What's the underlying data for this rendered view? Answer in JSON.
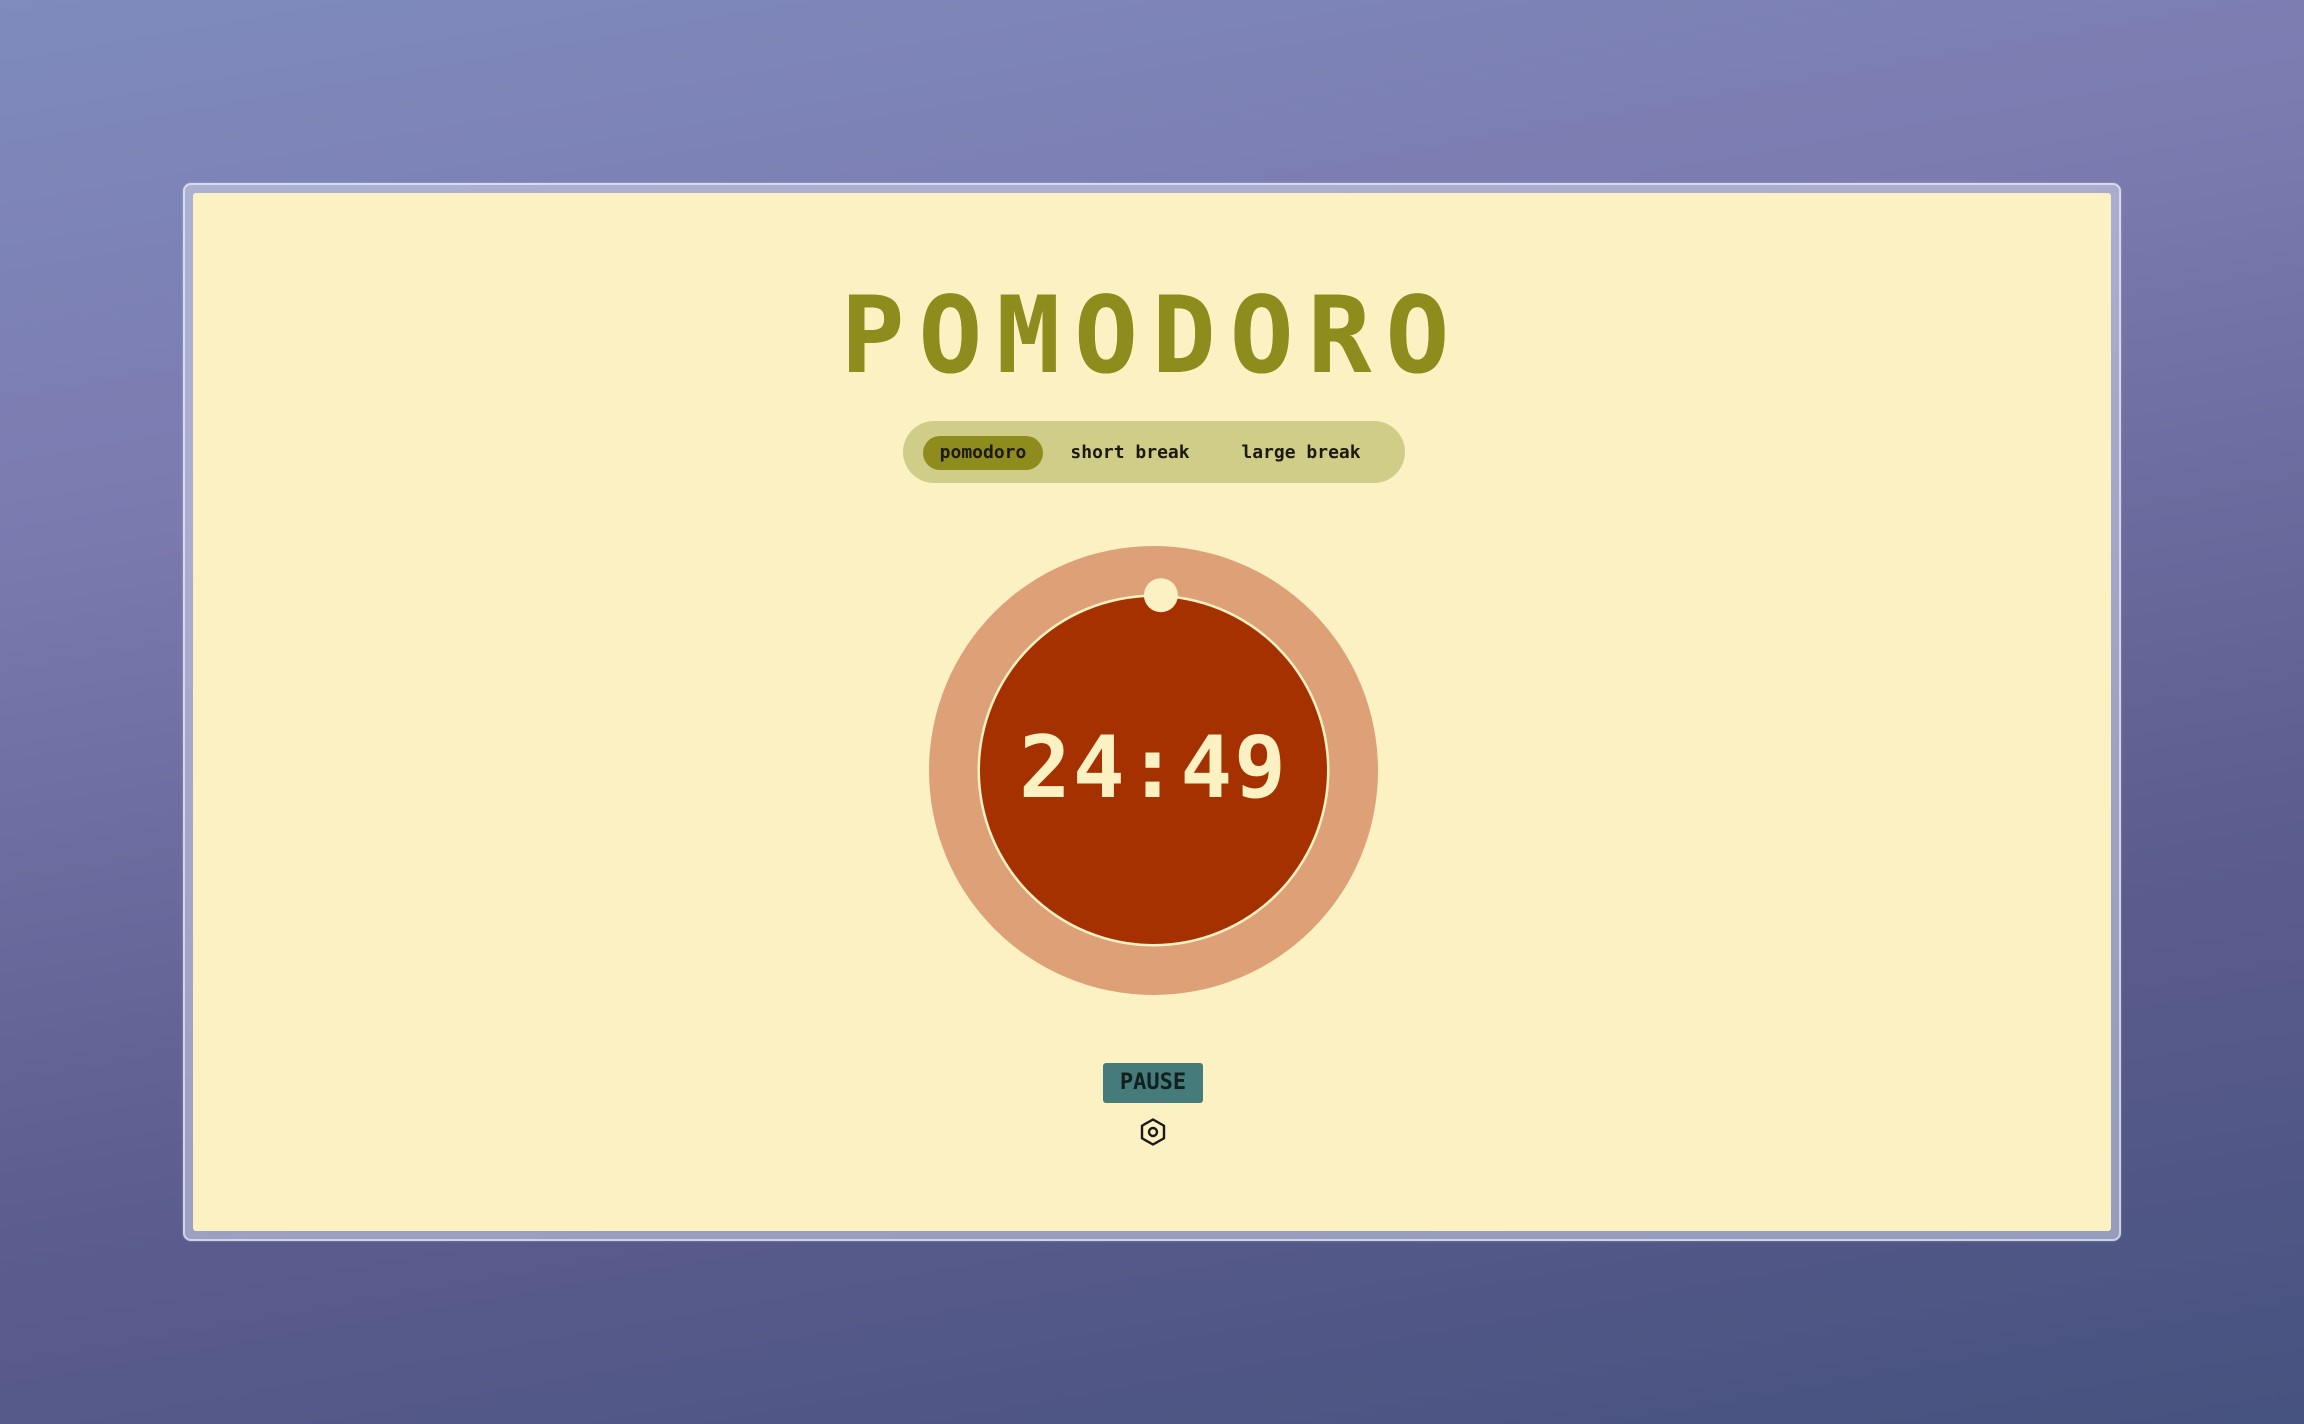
{
  "app": {
    "title": "POMODORO"
  },
  "modes": {
    "items": [
      {
        "label": "pomodoro",
        "active": true
      },
      {
        "label": "short break",
        "active": false
      },
      {
        "label": "large break",
        "active": false
      }
    ]
  },
  "timer": {
    "display": "24:49",
    "progress_fraction": 0.0067
  },
  "controls": {
    "pause_label": "PAUSE",
    "settings_icon": "settings-icon"
  },
  "colors": {
    "background": "#fbf1c2",
    "accent": "#8f8c1e",
    "ring_outer": "#dea077",
    "ring_inner": "#a53100",
    "button": "#457b7a"
  }
}
